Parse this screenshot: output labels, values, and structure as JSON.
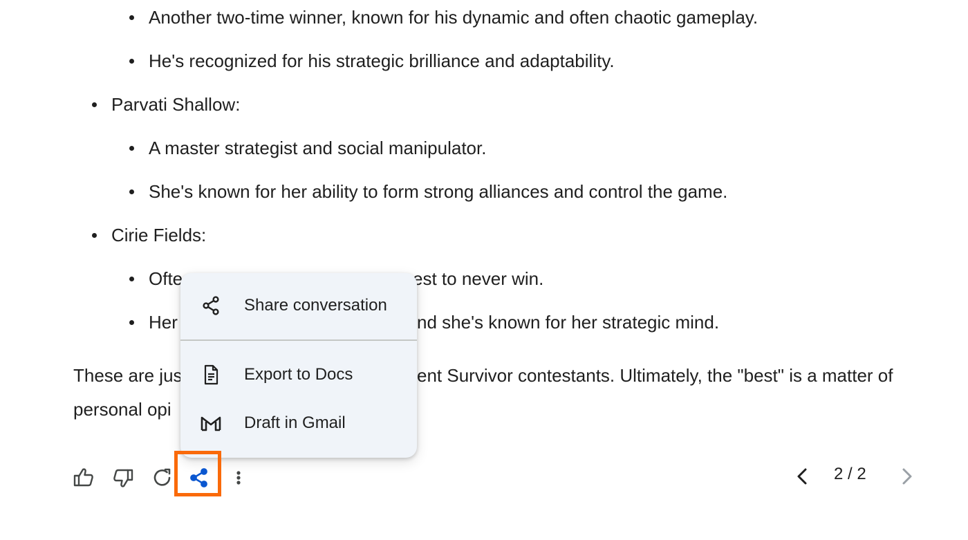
{
  "response": {
    "bullets": [
      "Another two-time winner, known for his dynamic and often chaotic gameplay.",
      "He's recognized for his strategic brilliance and adaptability.",
      "Parvati Shallow:",
      "A master strategist and social manipulator.",
      "She's known for her ability to form strong alliances and control the game.",
      "Cirie Fields:",
      "Often considered one of the best to never win.",
      "Her social game is legendary, and she's known for her strategic mind."
    ],
    "visible_fragments": {
      "cirie_sub1_left": "Ofte",
      "cirie_sub1_right": "est to never win.",
      "cirie_sub2_left": "Her",
      "cirie_sub2_right": "nd she's known for her strategic mind.",
      "para_line1_left": "These are jus",
      "para_line1_right": "ent Survivor contestants. Ultimately, the \"best\" is a matter of",
      "para_line2_left": "personal opi"
    }
  },
  "share_menu": {
    "items": [
      {
        "label": "Share conversation",
        "icon": "share-icon"
      },
      {
        "label": "Export to Docs",
        "icon": "docs-icon"
      },
      {
        "label": "Draft in Gmail",
        "icon": "gmail-icon"
      }
    ]
  },
  "actions": {
    "icons": [
      "thumbs-up-icon",
      "thumbs-down-icon",
      "regenerate-icon",
      "share-icon",
      "more-vert-icon"
    ],
    "highlight_color": "#fa6a0a",
    "share_color": "#0b57d0"
  },
  "pager": {
    "label": "2 / 2",
    "prev_icon": "chevron-left-icon",
    "next_icon": "chevron-right-icon"
  }
}
